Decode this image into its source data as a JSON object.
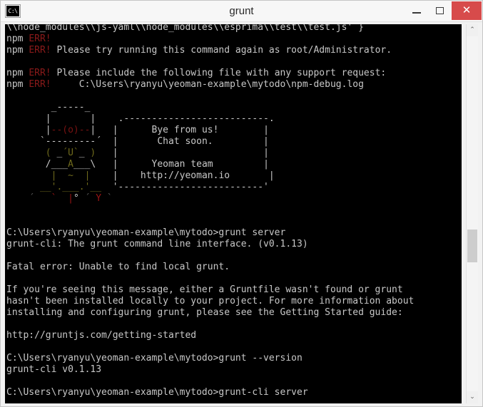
{
  "window": {
    "title": "grunt",
    "icon": "cmd-console-icon",
    "icon_text": "C:\\",
    "controls": {
      "minimize_label": "—",
      "maximize_label": "□",
      "close_label": "✕",
      "close_color": "#d74b4b"
    }
  },
  "scrollbar": {
    "up_arrow": "⌃",
    "down_arrow": "⌄",
    "thumb_position_percent": 60
  },
  "console": {
    "background": "#000000",
    "foreground": "#c8c8c8",
    "error_color": "#8b1a1a",
    "olive_color": "#6f6a1c",
    "red_art_color": "#7a1212",
    "lines": [
      {
        "segments": [
          {
            "t": "\\\\node_modules\\\\js-yaml\\\\node_modules\\\\esprima\\\\test\\\\test.js' }",
            "c": "normal"
          }
        ]
      },
      {
        "segments": [
          {
            "t": "npm ",
            "c": "normal"
          },
          {
            "t": "ERR!",
            "c": "err"
          }
        ]
      },
      {
        "segments": [
          {
            "t": "npm ",
            "c": "normal"
          },
          {
            "t": "ERR!",
            "c": "err"
          },
          {
            "t": " Please try running this command again as root/Administrator.",
            "c": "normal"
          }
        ]
      },
      {
        "segments": [
          {
            "t": "",
            "c": "normal"
          }
        ]
      },
      {
        "segments": [
          {
            "t": "npm ",
            "c": "normal"
          },
          {
            "t": "ERR!",
            "c": "err"
          },
          {
            "t": " Please include the following file with any support request:",
            "c": "normal"
          }
        ]
      },
      {
        "segments": [
          {
            "t": "npm ",
            "c": "normal"
          },
          {
            "t": "ERR!",
            "c": "err"
          },
          {
            "t": "     C:\\Users\\ryanyu\\yeoman-example\\mytodo\\npm-debug.log",
            "c": "normal"
          }
        ]
      },
      {
        "segments": [
          {
            "t": "",
            "c": "normal"
          }
        ]
      },
      {
        "segments": [
          {
            "t": "        ",
            "c": "normal"
          },
          {
            "t": "_-----_",
            "c": "art"
          }
        ]
      },
      {
        "segments": [
          {
            "t": "       ",
            "c": "normal"
          },
          {
            "t": "|       |",
            "c": "art"
          },
          {
            "t": "    ",
            "c": "normal"
          },
          {
            "t": ".--------------------------.",
            "c": "art"
          }
        ]
      },
      {
        "segments": [
          {
            "t": "       ",
            "c": "normal"
          },
          {
            "t": "|",
            "c": "art"
          },
          {
            "t": "--(o)--",
            "c": "art-red"
          },
          {
            "t": "|",
            "c": "art"
          },
          {
            "t": "   ",
            "c": "normal"
          },
          {
            "t": "|",
            "c": "art"
          },
          {
            "t": "      Bye from us!        ",
            "c": "normal"
          },
          {
            "t": "|",
            "c": "art"
          }
        ]
      },
      {
        "segments": [
          {
            "t": "      ",
            "c": "normal"
          },
          {
            "t": "`---------´",
            "c": "art"
          },
          {
            "t": "  ",
            "c": "normal"
          },
          {
            "t": "|",
            "c": "art"
          },
          {
            "t": "       Chat soon.         ",
            "c": "normal"
          },
          {
            "t": "|",
            "c": "art"
          }
        ]
      },
      {
        "segments": [
          {
            "t": "       ",
            "c": "normal"
          },
          {
            "t": "(",
            "c": "art-olive"
          },
          {
            "t": " _",
            "c": "art"
          },
          {
            "t": "´U`",
            "c": "art-olive"
          },
          {
            "t": "_ ",
            "c": "art"
          },
          {
            "t": ")",
            "c": "art-olive"
          },
          {
            "t": "   ",
            "c": "normal"
          },
          {
            "t": "|",
            "c": "art"
          },
          {
            "t": "                          ",
            "c": "normal"
          },
          {
            "t": "|",
            "c": "art"
          }
        ]
      },
      {
        "segments": [
          {
            "t": "       ",
            "c": "normal"
          },
          {
            "t": "/___",
            "c": "art"
          },
          {
            "t": "A",
            "c": "art-olive"
          },
          {
            "t": "___\\",
            "c": "art"
          },
          {
            "t": "   ",
            "c": "normal"
          },
          {
            "t": "|",
            "c": "art"
          },
          {
            "t": "      Yeoman team         ",
            "c": "normal"
          },
          {
            "t": "|",
            "c": "art"
          }
        ]
      },
      {
        "segments": [
          {
            "t": "        ",
            "c": "normal"
          },
          {
            "t": "|  ~  |",
            "c": "art-olive"
          },
          {
            "t": "    ",
            "c": "normal"
          },
          {
            "t": "|",
            "c": "art"
          },
          {
            "t": "    http://yeoman.io       ",
            "c": "normal"
          },
          {
            "t": "|",
            "c": "art"
          }
        ]
      },
      {
        "segments": [
          {
            "t": "      ",
            "c": "normal"
          },
          {
            "t": "__'.___.'__",
            "c": "art-olive"
          },
          {
            "t": "  ",
            "c": "normal"
          },
          {
            "t": "'--------------------------'",
            "c": "art"
          }
        ]
      },
      {
        "segments": [
          {
            "t": "    ",
            "c": "normal"
          },
          {
            "t": "´   ",
            "c": "art-dim"
          },
          {
            "t": "`  ",
            "c": "art-redbright"
          },
          {
            "t": "|",
            "c": "art-redbright"
          },
          {
            "t": "°",
            "c": "art"
          },
          {
            "t": " ´",
            "c": "art-dim"
          },
          {
            "t": " Y",
            "c": "art-redbright"
          },
          {
            "t": " `",
            "c": "art-dim"
          }
        ]
      },
      {
        "segments": [
          {
            "t": "",
            "c": "normal"
          }
        ]
      },
      {
        "segments": [
          {
            "t": "",
            "c": "normal"
          }
        ]
      },
      {
        "segments": [
          {
            "t": "C:\\Users\\ryanyu\\yeoman-example\\mytodo>grunt server",
            "c": "normal"
          }
        ]
      },
      {
        "segments": [
          {
            "t": "grunt-cli: The grunt command line interface. (v0.1.13)",
            "c": "normal"
          }
        ]
      },
      {
        "segments": [
          {
            "t": "",
            "c": "normal"
          }
        ]
      },
      {
        "segments": [
          {
            "t": "Fatal error: Unable to find local grunt.",
            "c": "normal"
          }
        ]
      },
      {
        "segments": [
          {
            "t": "",
            "c": "normal"
          }
        ]
      },
      {
        "segments": [
          {
            "t": "If you're seeing this message, either a Gruntfile wasn't found or grunt",
            "c": "normal"
          }
        ]
      },
      {
        "segments": [
          {
            "t": "hasn't been installed locally to your project. For more information about",
            "c": "normal"
          }
        ]
      },
      {
        "segments": [
          {
            "t": "installing and configuring grunt, please see the Getting Started guide:",
            "c": "normal"
          }
        ]
      },
      {
        "segments": [
          {
            "t": "",
            "c": "normal"
          }
        ]
      },
      {
        "segments": [
          {
            "t": "http://gruntjs.com/getting-started",
            "c": "normal"
          }
        ]
      },
      {
        "segments": [
          {
            "t": "",
            "c": "normal"
          }
        ]
      },
      {
        "segments": [
          {
            "t": "C:\\Users\\ryanyu\\yeoman-example\\mytodo>grunt --version",
            "c": "normal"
          }
        ]
      },
      {
        "segments": [
          {
            "t": "grunt-cli v0.1.13",
            "c": "normal"
          }
        ]
      },
      {
        "segments": [
          {
            "t": "",
            "c": "normal"
          }
        ]
      },
      {
        "segments": [
          {
            "t": "C:\\Users\\ryanyu\\yeoman-example\\mytodo>grunt-cli server",
            "c": "normal"
          }
        ]
      }
    ]
  }
}
